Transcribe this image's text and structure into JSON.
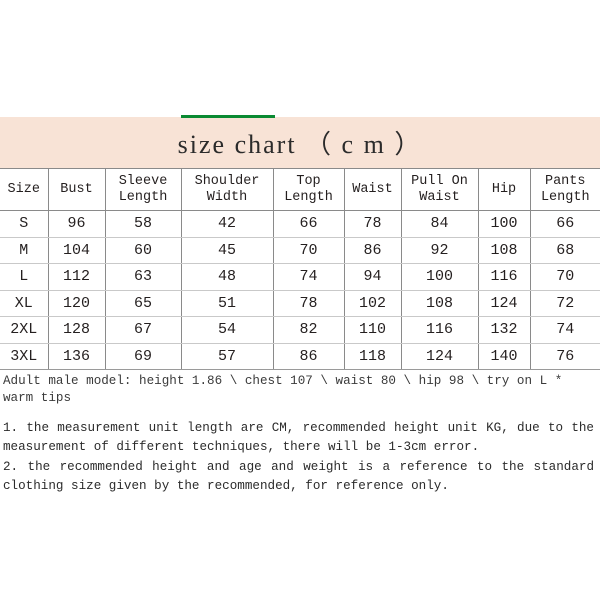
{
  "accent": {
    "green_rule_color": "#0A8A32",
    "title_band_color": "#F8E3D6"
  },
  "title": {
    "text": "size chart （ c m ）"
  },
  "chart_data": {
    "type": "table",
    "title": "size chart （ c m ）",
    "columns": [
      "Size",
      "Sleeve\nLength",
      "Shoulder\nWidth",
      "Top\nLength",
      "Waist",
      "Pull On\nWaist",
      "Hip",
      "Pants\nLength"
    ],
    "headers": [
      "Size",
      "Bust",
      "Sleeve\nLength",
      "Shoulder\nWidth",
      "Top\nLength",
      "Waist",
      "Pull On\nWaist",
      "Hip",
      "Pants\nLength"
    ],
    "rows": [
      [
        "S",
        "96",
        "58",
        "42",
        "66",
        "78",
        "84",
        "100",
        "66"
      ],
      [
        "M",
        "104",
        "60",
        "45",
        "70",
        "86",
        "92",
        "108",
        "68"
      ],
      [
        "L",
        "112",
        "63",
        "48",
        "74",
        "94",
        "100",
        "116",
        "70"
      ],
      [
        "XL",
        "120",
        "65",
        "51",
        "78",
        "102",
        "108",
        "124",
        "72"
      ],
      [
        "2XL",
        "128",
        "67",
        "54",
        "82",
        "110",
        "116",
        "132",
        "74"
      ],
      [
        "3XL",
        "136",
        "69",
        "57",
        "86",
        "118",
        "124",
        "140",
        "76"
      ]
    ],
    "unit": "cm"
  },
  "model_note": "Adult male model: height 1.86 \\ chest 107 \\ waist 80 \\ hip 98 \\ try on L * warm tips",
  "notes": [
    "1. the measurement unit length are CM, recommended height unit KG, due to the measurement of different techniques, there will be 1-3cm error.",
    "2. the recommended height and age and weight is a reference to the standard clothing size given by the recommended, for reference only."
  ]
}
